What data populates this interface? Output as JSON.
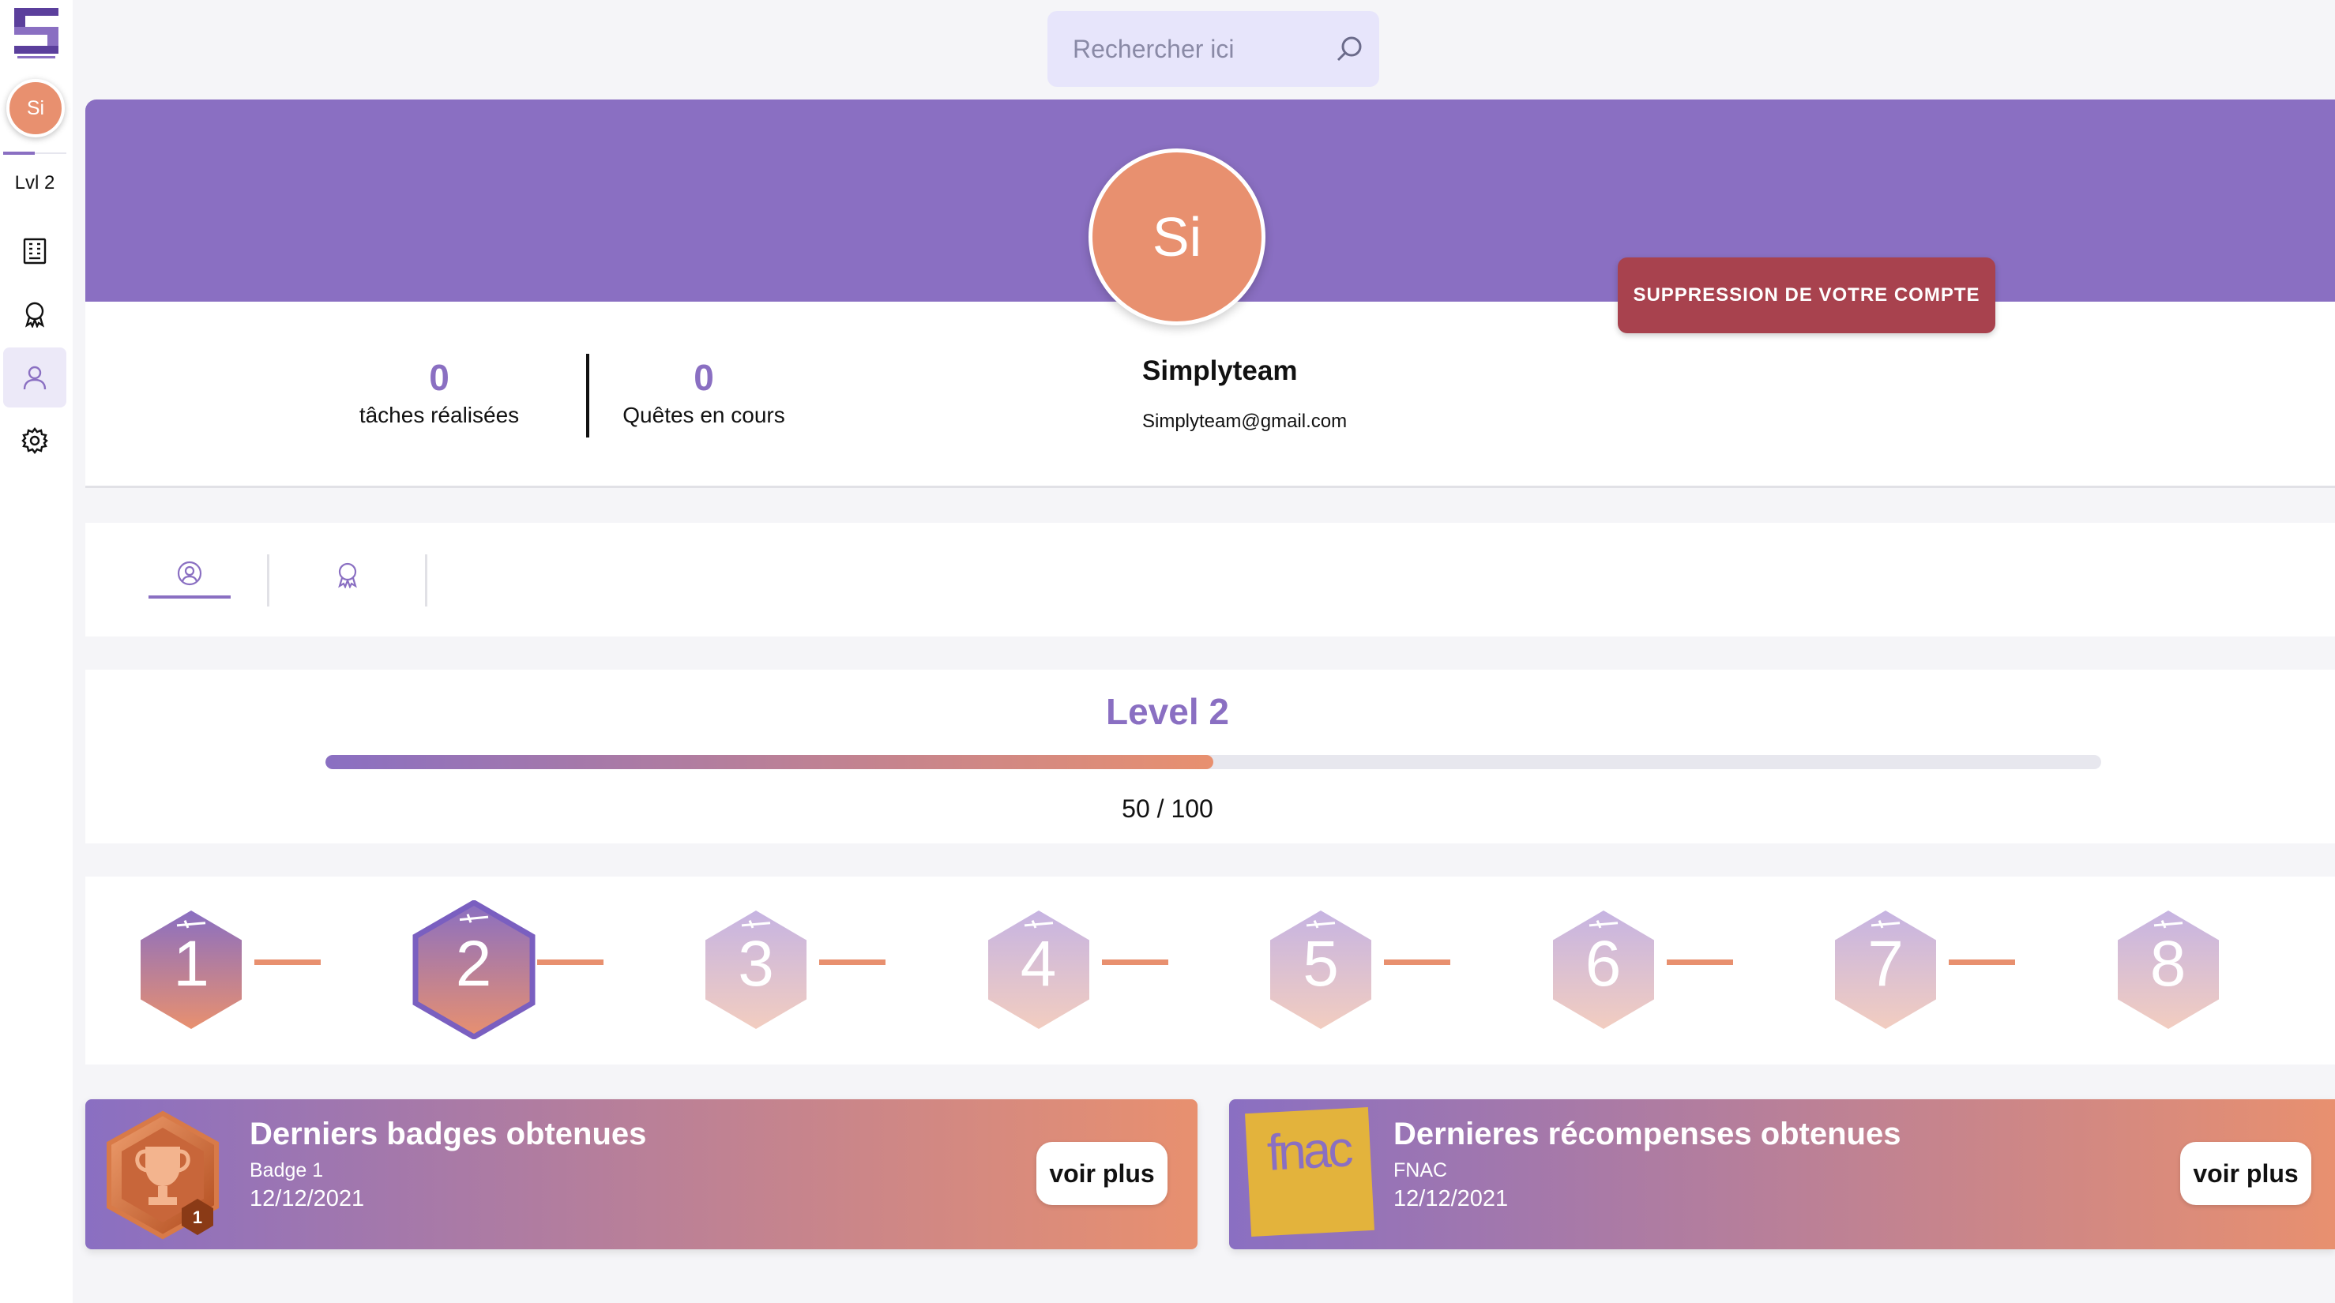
{
  "sidebar": {
    "avatar_initials": "Si",
    "level_label": "Lvl 2",
    "nav": [
      {
        "icon": "building-icon"
      },
      {
        "icon": "badge-icon"
      },
      {
        "icon": "user-icon",
        "active": true
      },
      {
        "icon": "gear-icon"
      }
    ]
  },
  "search": {
    "placeholder": "Rechercher ici"
  },
  "profile": {
    "avatar_initials": "Si",
    "name": "Simplyteam",
    "email": "Simplyteam@gmail.com",
    "delete_label": "SUPPRESSION DE VOTRE COMPTE",
    "stats": [
      {
        "value": "0",
        "label": "tâches réalisées"
      },
      {
        "value": "0",
        "label": "Quêtes en cours"
      }
    ]
  },
  "tabs": [
    {
      "icon": "user-circle-icon",
      "active": true
    },
    {
      "icon": "badge-icon",
      "active": false
    }
  ],
  "level": {
    "title": "Level 2",
    "progress_current": 50,
    "progress_max": 100,
    "progress_text": "50 / 100"
  },
  "levels": {
    "items": [
      "1",
      "2",
      "3",
      "4",
      "5",
      "6",
      "7",
      "8"
    ],
    "current": "2"
  },
  "badges_card": {
    "title": "Derniers badges obtenues",
    "item": "Badge 1",
    "date": "12/12/2021",
    "badge_number": "1",
    "button": "voir plus"
  },
  "rewards_card": {
    "title": "Dernieres récompenses obtenues",
    "item": "FNAC",
    "date": "12/12/2021",
    "logo_text": "fnac",
    "button": "voir plus"
  },
  "colors": {
    "primary": "#8a6fc2",
    "accent": "#e8906f",
    "danger": "#a8424e"
  }
}
